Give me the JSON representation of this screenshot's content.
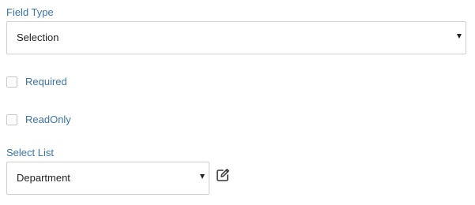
{
  "form": {
    "field_type": {
      "label": "Field Type",
      "selected": "Selection"
    },
    "required": {
      "label": "Required",
      "checked": false
    },
    "readonly": {
      "label": "ReadOnly",
      "checked": false
    },
    "select_list": {
      "label": "Select List",
      "selected": "Department",
      "edit_icon": "edit-icon"
    }
  },
  "colors": {
    "label": "#3a74b2",
    "border": "#cfcfcf",
    "text": "#222222"
  }
}
